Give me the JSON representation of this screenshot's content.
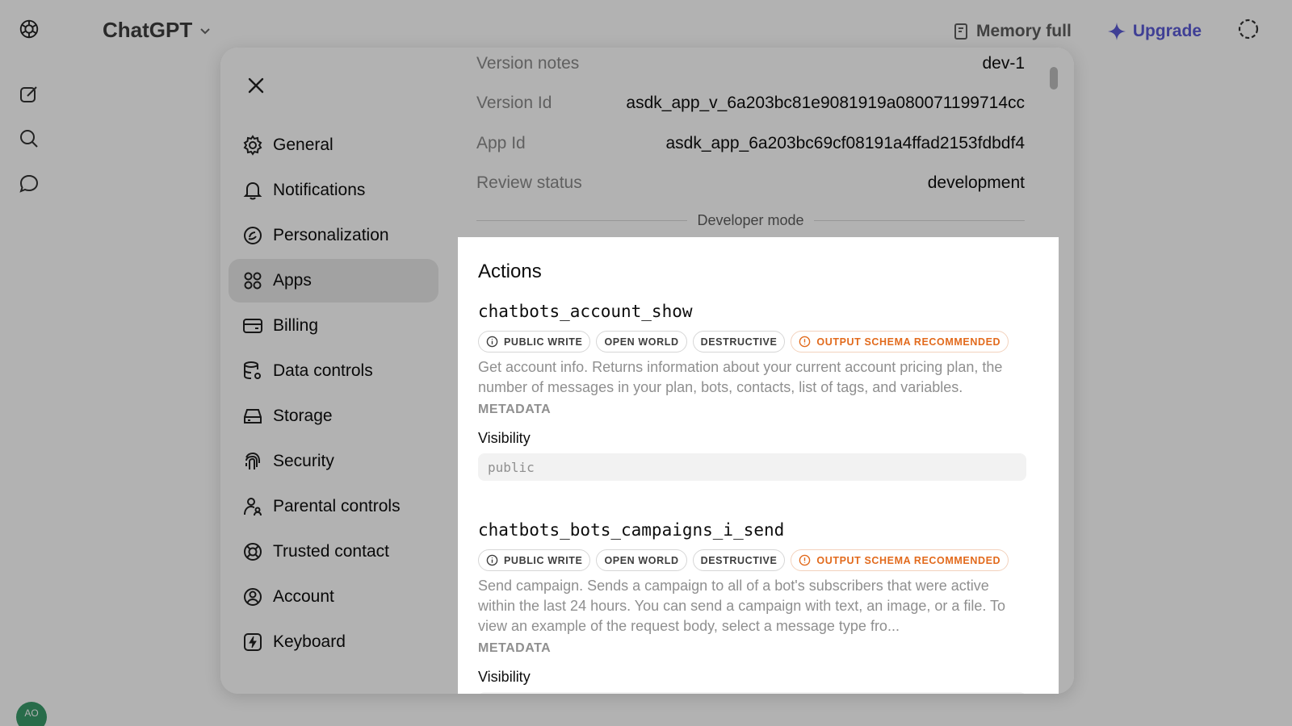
{
  "app": {
    "title": "ChatGPT",
    "memory_label": "Memory full",
    "upgrade_label": "Upgrade",
    "avatar_initials": "AO"
  },
  "nav": {
    "items": [
      {
        "label": "General",
        "icon": "gear-icon"
      },
      {
        "label": "Notifications",
        "icon": "bell-icon"
      },
      {
        "label": "Personalization",
        "icon": "personalization-icon"
      },
      {
        "label": "Apps",
        "icon": "apps-grid-icon",
        "active": true
      },
      {
        "label": "Billing",
        "icon": "card-icon"
      },
      {
        "label": "Data controls",
        "icon": "database-icon"
      },
      {
        "label": "Storage",
        "icon": "storage-icon"
      },
      {
        "label": "Security",
        "icon": "fingerprint-icon"
      },
      {
        "label": "Parental controls",
        "icon": "parent-icon"
      },
      {
        "label": "Trusted contact",
        "icon": "lifebuoy-icon"
      },
      {
        "label": "Account",
        "icon": "account-icon"
      },
      {
        "label": "Keyboard",
        "icon": "keyboard-icon"
      }
    ]
  },
  "details": {
    "version_notes": {
      "label": "Version notes",
      "value": "dev-1"
    },
    "version_id": {
      "label": "Version Id",
      "value": "asdk_app_v_6a203bc81e9081919a080071199714cc"
    },
    "app_id": {
      "label": "App Id",
      "value": "asdk_app_6a203bc69cf08191a4ffad2153fdbdf4"
    },
    "review_status": {
      "label": "Review status",
      "value": "development"
    },
    "divider_label": "Developer mode"
  },
  "actions": {
    "title": "Actions",
    "items": [
      {
        "name": "chatbots_account_show",
        "badges": [
          "PUBLIC WRITE",
          "OPEN WORLD",
          "DESTRUCTIVE",
          "OUTPUT SCHEMA RECOMMENDED"
        ],
        "description": "Get account info. Returns information about your current account pricing plan, the number of messages in your plan, bots, contacts, list of tags, and variables.",
        "metadata_label": "METADATA",
        "visibility_label": "Visibility",
        "visibility_value": "public"
      },
      {
        "name": "chatbots_bots_campaigns_i_send",
        "badges": [
          "PUBLIC WRITE",
          "OPEN WORLD",
          "DESTRUCTIVE",
          "OUTPUT SCHEMA RECOMMENDED"
        ],
        "description": "Send campaign. Sends a campaign to all of a bot's subscribers that were active within the last 24 hours. You can send a campaign with text, an image, or a file. To view an example of the request body, select a message type fro...",
        "metadata_label": "METADATA",
        "visibility_label": "Visibility",
        "visibility_value": ""
      }
    ]
  },
  "colors": {
    "warning": "#e26a1c",
    "upgrade": "#5b5bd6",
    "active_nav_bg": "#e8e8e8"
  }
}
